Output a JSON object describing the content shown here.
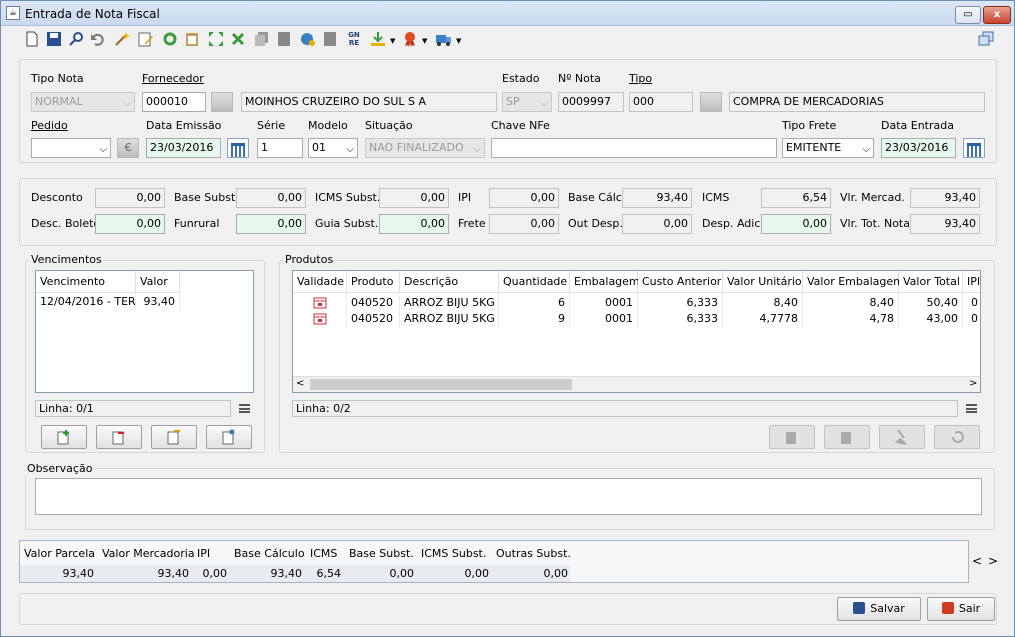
{
  "window": {
    "title": "Entrada de Nota Fiscal",
    "min_glyph": "▭",
    "close_glyph": "x"
  },
  "toolbar_icons": [
    "new-doc-icon",
    "save-disk-icon",
    "search-key-icon",
    "undo-icon",
    "wand-icon",
    "edit-doc-icon",
    "refresh-icon",
    "clipboard-icon",
    "expand-icon",
    "delete-x-icon",
    "copy-icon",
    "book-icon",
    "globe-user-icon",
    "grid-icon",
    "gnre-icon",
    "download-icon",
    "ribbon-icon",
    "truck-icon",
    "restore-window-icon"
  ],
  "toolbar_gnre": "GN RE",
  "header": {
    "tipo_nota": {
      "label": "Tipo Nota",
      "value": "NORMAL"
    },
    "fornecedor": {
      "label": "Fornecedor",
      "code": "000010",
      "name": "MOINHOS CRUZEIRO DO SUL S A"
    },
    "estado": {
      "label": "Estado",
      "value": "SP"
    },
    "numero_nota": {
      "label": "Nº Nota",
      "value": "0009997"
    },
    "tipo": {
      "label": "Tipo",
      "code": "000",
      "desc": "COMPRA DE MERCADORIAS"
    },
    "pedido": {
      "label": "Pedido",
      "value": ""
    },
    "data_emissao": {
      "label": "Data Emissão",
      "value": "23/03/2016"
    },
    "serie": {
      "label": "Série",
      "value": "1"
    },
    "modelo": {
      "label": "Modelo",
      "value": "01"
    },
    "situacao": {
      "label": "Situação",
      "value": "NAO FINALIZADO"
    },
    "chave_nfe": {
      "label": "Chave NFe",
      "value": ""
    },
    "tipo_frete": {
      "label": "Tipo Frete",
      "value": "EMITENTE"
    },
    "data_entrada": {
      "label": "Data Entrada",
      "value": "23/03/2016"
    },
    "euro_glyph": "€"
  },
  "totals": {
    "desconto": {
      "label": "Desconto",
      "value": "0,00"
    },
    "base_subst": {
      "label": "Base Subst.",
      "value": "0,00"
    },
    "icms_subst": {
      "label": "ICMS Subst.",
      "value": "0,00"
    },
    "ipi": {
      "label": "IPI",
      "value": "0,00"
    },
    "base_calc": {
      "label": "Base Cálc",
      "value": "93,40"
    },
    "icms": {
      "label": "ICMS",
      "value": "6,54"
    },
    "vlr_mercad": {
      "label": "Vlr. Mercad.",
      "value": "93,40"
    },
    "desc_boleto": {
      "label": "Desc. Boleto",
      "value": "0,00"
    },
    "funrural": {
      "label": "Funrural",
      "value": "0,00"
    },
    "guia_subst": {
      "label": "Guia Subst.",
      "value": "0,00"
    },
    "frete": {
      "label": "Frete",
      "value": "0,00"
    },
    "out_desp": {
      "label": "Out Desp.",
      "value": "0,00"
    },
    "desp_adic": {
      "label": "Desp. Adic.",
      "value": "0,00"
    },
    "vlr_tot_nota": {
      "label": "Vlr. Tot. Nota",
      "value": "93,40"
    }
  },
  "vencimentos": {
    "title": "Vencimentos",
    "columns": [
      "Vencimento",
      "Valor"
    ],
    "rows": [
      [
        "12/04/2016 - TER",
        "93,40"
      ]
    ],
    "status": "Linha: 0/1"
  },
  "produtos": {
    "title": "Produtos",
    "columns": [
      "Validade",
      "Produto",
      "Descrição",
      "Quantidade",
      "Embalagem",
      "Custo Anterior",
      "Valor Unitário",
      "Valor Embalagem",
      "Valor Total",
      "IPI"
    ],
    "rows": [
      [
        "",
        "040520",
        "ARROZ BIJU 5KG",
        "6",
        "0001",
        "6,333",
        "8,40",
        "8,40",
        "50,40",
        "0"
      ],
      [
        "",
        "040520",
        "ARROZ BIJU 5KG",
        "9",
        "0001",
        "6,333",
        "4,7778",
        "4,78",
        "43,00",
        "0"
      ]
    ],
    "status": "Linha: 0/2",
    "scroll_left": "<",
    "scroll_right": ">"
  },
  "observacao": {
    "label": "Observação",
    "value": ""
  },
  "summary": {
    "columns": [
      "Valor Parcela",
      "Valor Mercadoria",
      "IPI",
      "Base Cálculo",
      "ICMS",
      "Base Subst.",
      "ICMS Subst.",
      "Outras Subst."
    ],
    "values": [
      "93,40",
      "93,40",
      "0,00",
      "93,40",
      "6,54",
      "0,00",
      "0,00",
      "0,00"
    ],
    "nav_prev": "<",
    "nav_next": ">"
  },
  "buttons": {
    "salvar": "Salvar",
    "sair": "Sair"
  },
  "colors": {
    "accent": "#2b5e9f",
    "green_field": "#e6f7ec",
    "close_red": "#c7452e"
  }
}
